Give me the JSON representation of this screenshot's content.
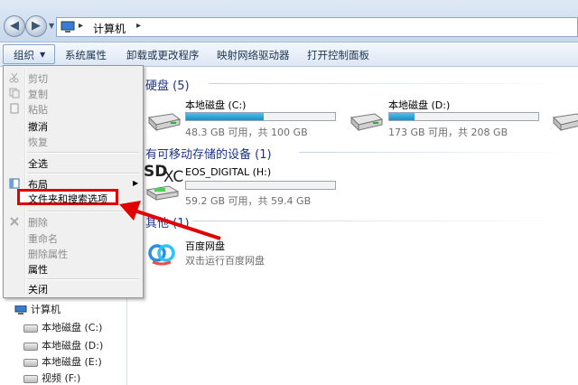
{
  "address": {
    "crumb": "计算机",
    "sep": "▸"
  },
  "toolbar": {
    "organize": "组织",
    "system_properties": "系统属性",
    "uninstall": "卸载或更改程序",
    "map_drive": "映射网络驱动器",
    "control_panel": "打开控制面板"
  },
  "menu": {
    "cut": "剪切",
    "copy": "复制",
    "paste": "粘贴",
    "undo": "撤消",
    "redo": "恢复",
    "select_all": "全选",
    "layout": "布局",
    "folder_options": "文件夹和搜索选项",
    "delete": "删除",
    "rename": "重命名",
    "remove_props": "删除属性",
    "properties": "属性",
    "close": "关闭"
  },
  "nav": {
    "computer": "计算机",
    "drives": [
      "本地磁盘 (C:)",
      "本地磁盘 (D:)",
      "本地磁盘 (E:)",
      "视频 (F:)"
    ]
  },
  "groups": {
    "hard_disks": "硬盘 (5)",
    "removable": "有可移动存储的设备 (1)",
    "other": "其他 (1)"
  },
  "drives": [
    {
      "name": "本地磁盘 (C:)",
      "info": "48.3 GB 可用，共 100 GB",
      "used": 0.52
    },
    {
      "name": "本地磁盘 (D:)",
      "info": "173 GB 可用，共 208 GB",
      "used": 0.17
    },
    {
      "name": "EOS_DIGITAL (H:)",
      "info": "59.2 GB 可用，共 59.4 GB",
      "used": 0.003
    }
  ],
  "sdxc_label": {
    "sd": "SD",
    "xc": "XC"
  },
  "baidu": {
    "name": "百度网盘",
    "desc": "双击运行百度网盘"
  },
  "colors": {
    "highlight": "#e00000",
    "drive_fill": "#1a8fc7",
    "group_text": "#1e3287"
  }
}
